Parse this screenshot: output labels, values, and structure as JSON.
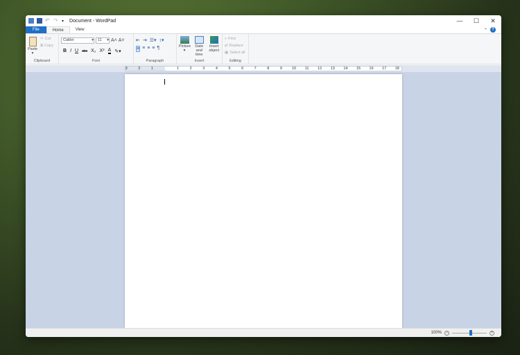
{
  "window": {
    "title": "Document - WordPad",
    "minimize": "—",
    "maximize": "☐",
    "close": "✕"
  },
  "quick_access": {
    "save_icon": "save-icon",
    "undo_icon": "undo-icon",
    "redo_icon": "redo-icon",
    "customize": "▾"
  },
  "tabs": [
    {
      "label": "File"
    },
    {
      "label": "Home"
    },
    {
      "label": "View"
    }
  ],
  "help": {
    "collapse": "⌃",
    "help": "?"
  },
  "clipboard": {
    "paste": "Paste",
    "cut": "Cut",
    "copy": "Copy",
    "label": "Clipboard"
  },
  "font": {
    "family": "Calibri",
    "size": "11",
    "grow": "A˄",
    "shrink": "A˅",
    "bold": "B",
    "italic": "I",
    "underline": "U",
    "strike": "abc",
    "subscript": "X₂",
    "superscript": "X²",
    "color": "A",
    "label": "Font"
  },
  "paragraph": {
    "label": "Paragraph"
  },
  "insert": {
    "picture": "Picture",
    "datetime": "Date and time",
    "object": "Insert object",
    "label": "Insert"
  },
  "editing": {
    "find": "Find",
    "replace": "Replace",
    "select_all": "Select all",
    "label": "Editing"
  },
  "ruler": {
    "left": [
      "3",
      "2",
      "1"
    ],
    "right": [
      "1",
      "2",
      "3",
      "4",
      "5",
      "6",
      "7",
      "8",
      "9",
      "10",
      "11",
      "12",
      "13",
      "14",
      "15",
      "16",
      "17",
      "18"
    ]
  },
  "status": {
    "zoom": "100%",
    "zoom_out": "−",
    "zoom_in": "+",
    "zoom_level": 100
  },
  "colors": {
    "accent": "#1e6fc6",
    "doc_bg": "#c8d3e6"
  }
}
